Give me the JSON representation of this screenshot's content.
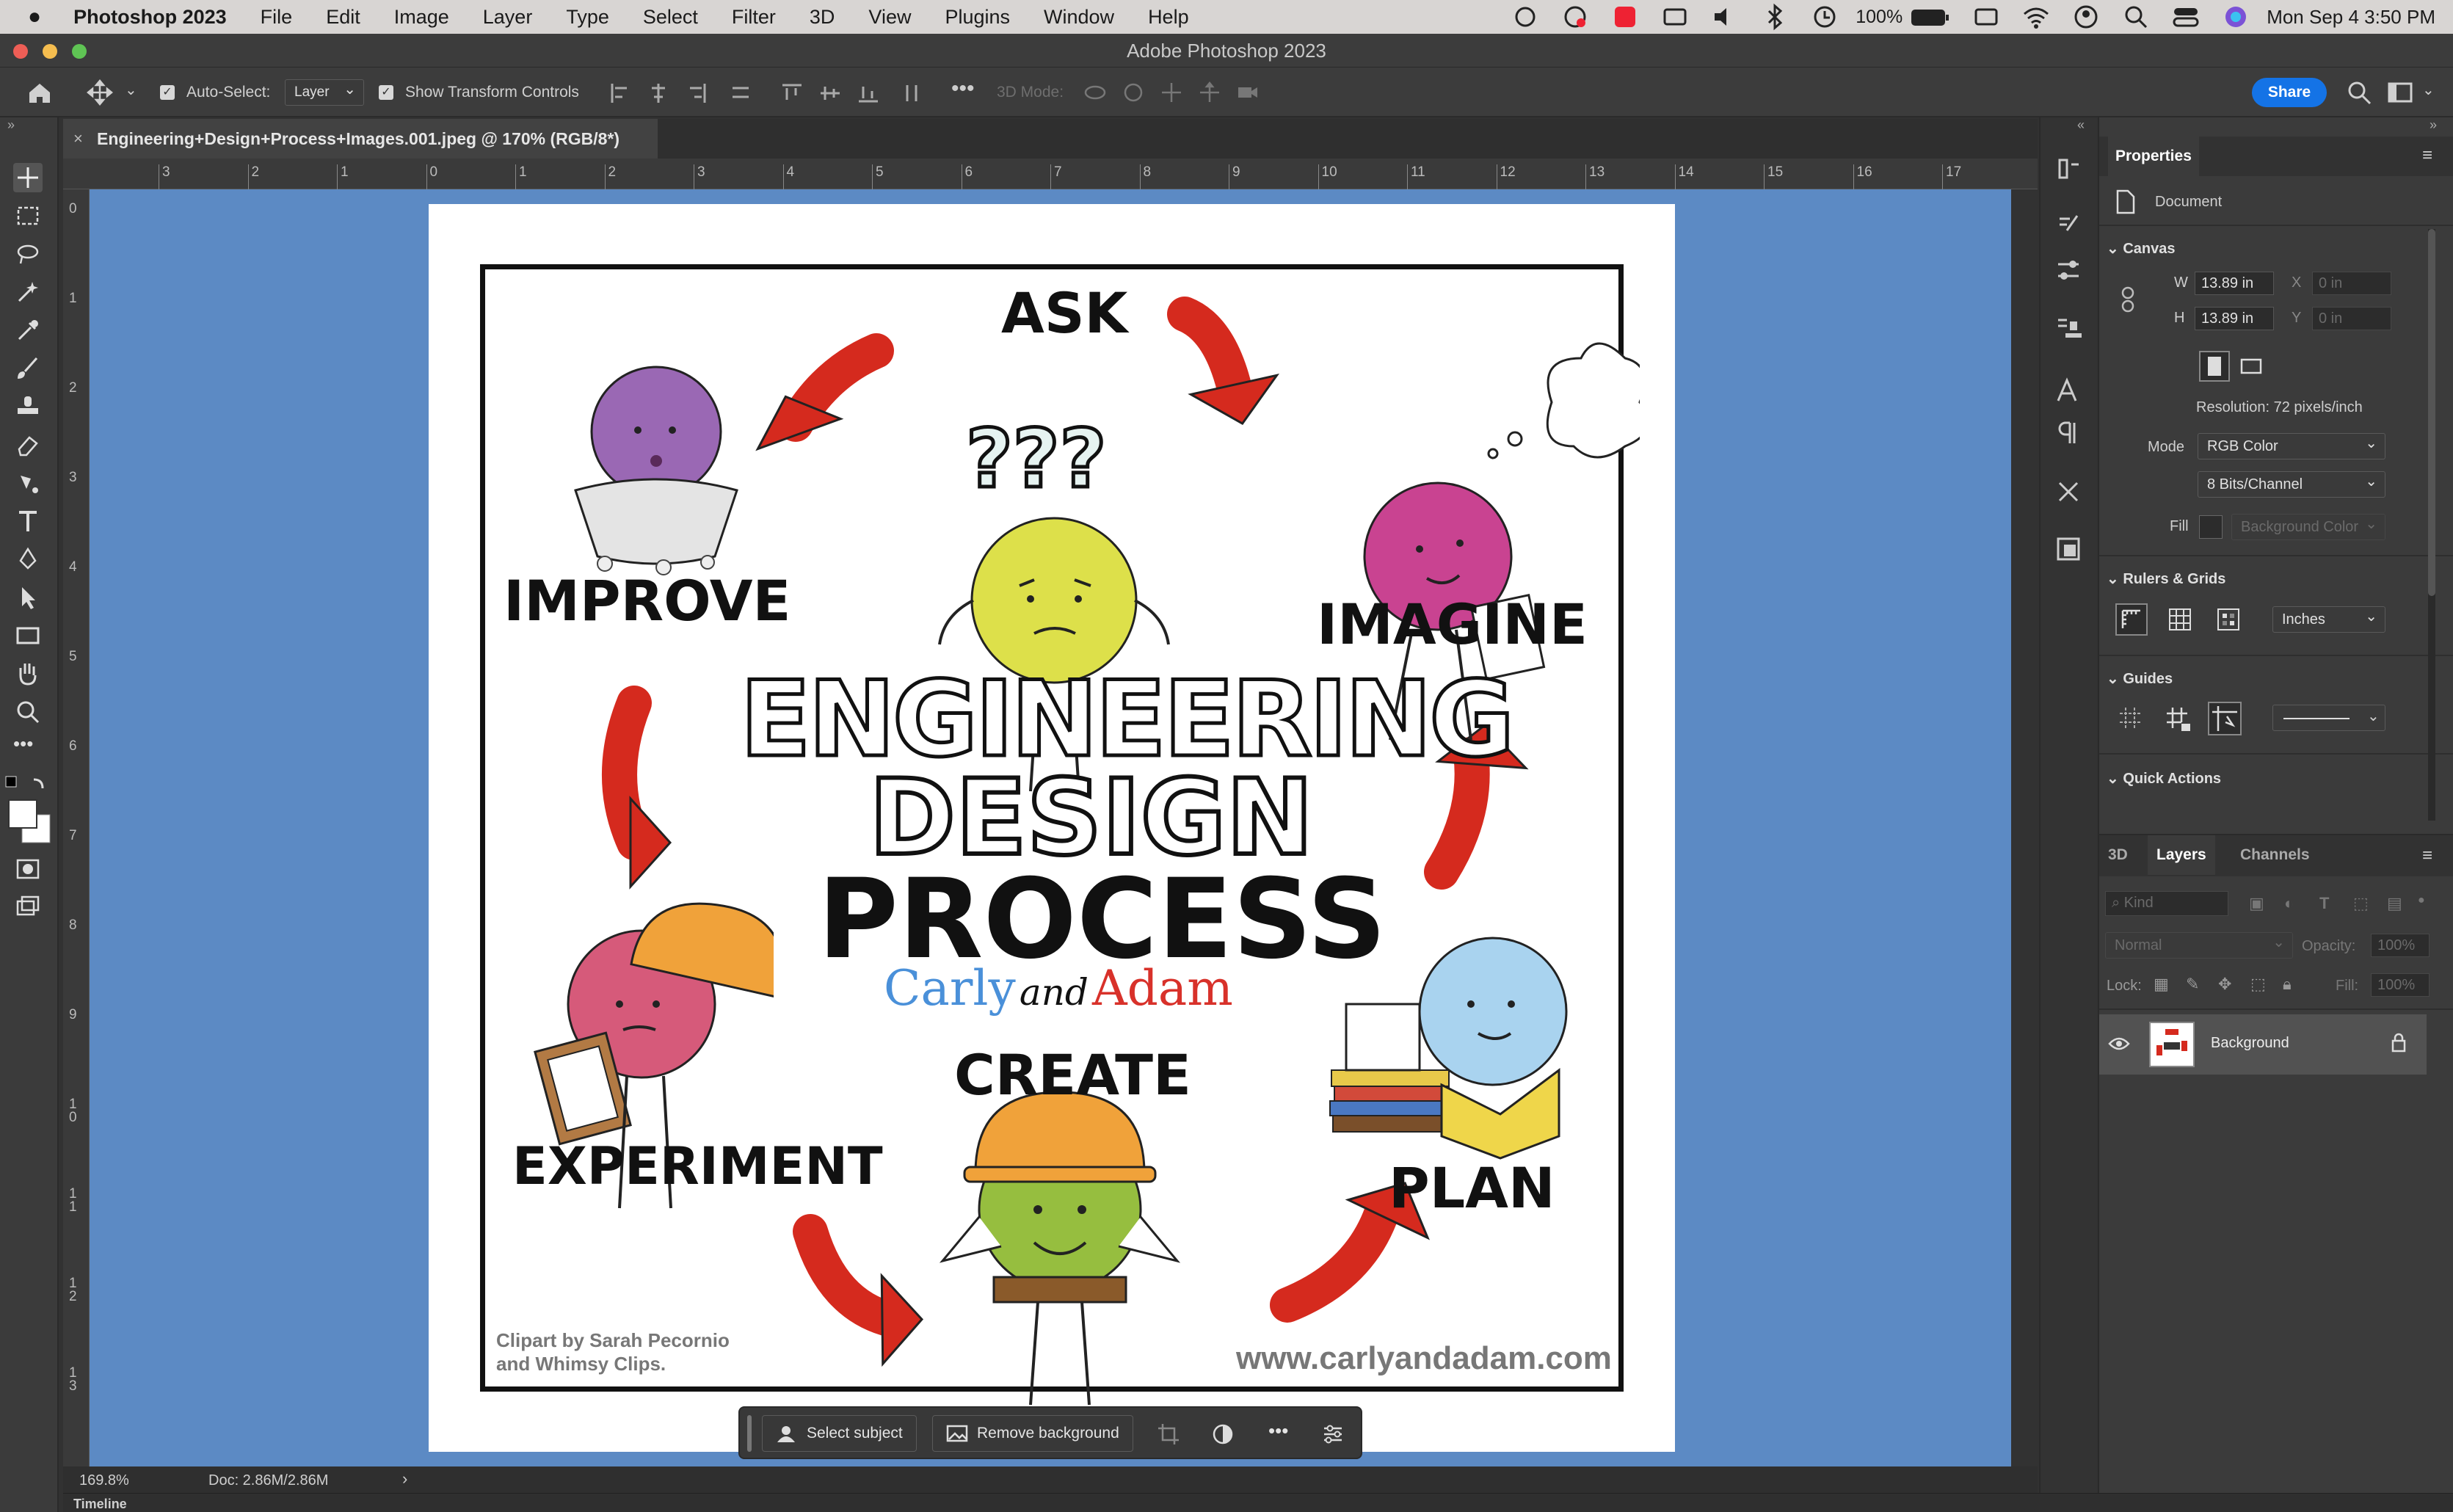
{
  "menubar": {
    "app_name": "Photoshop 2023",
    "items": [
      "File",
      "Edit",
      "Image",
      "Layer",
      "Type",
      "Select",
      "Filter",
      "3D",
      "View",
      "Plugins",
      "Window",
      "Help"
    ],
    "battery": "100%",
    "datetime": "Mon Sep 4  3:50 PM"
  },
  "window": {
    "title": "Adobe Photoshop 2023"
  },
  "options": {
    "auto_select_label": "Auto-Select:",
    "auto_select_value": "Layer",
    "transform_label": "Show Transform Controls",
    "mode_3d_label": "3D Mode:",
    "share_label": "Share"
  },
  "document": {
    "tab_title": "Engineering+Design+Process+Images.001.jpeg @ 170% (RGB/8*)",
    "zoom": "169.8%",
    "doc_size": "Doc: 2.86M/2.86M",
    "ruler_top": [
      "3",
      "2",
      "1",
      "0",
      "1",
      "2",
      "3",
      "4",
      "5",
      "6",
      "7",
      "8",
      "9",
      "10",
      "11",
      "12",
      "13",
      "14",
      "15",
      "16",
      "17"
    ],
    "ruler_left": [
      "0",
      "1",
      "2",
      "3",
      "4",
      "5",
      "6",
      "7",
      "8",
      "9",
      "1 0",
      "1 1",
      "1 2",
      "1 3"
    ]
  },
  "artwork": {
    "title_line1": "ENGINEERING",
    "title_line2": "DESIGN",
    "title_line3": "PROCESS",
    "brand_1": "Carly",
    "brand_and": "and",
    "brand_2": "Adam",
    "steps": [
      "ASK",
      "IMAGINE",
      "PLAN",
      "CREATE",
      "EXPERIMENT",
      "IMPROVE"
    ],
    "credit_line1": "Clipart by Sarah Pecornio",
    "credit_line2": "and Whimsy Clips.",
    "website": "www.carlyandadam.com",
    "question_marks": "???",
    "colors": {
      "arrow": "#d52a1e",
      "ask": "#dde04a",
      "imagine": "#c94391",
      "plan": "#a9d3ef",
      "create": "#96be3f",
      "experiment": "#d65a7a",
      "improve": "#9a68b4",
      "hat": "#f0a23a",
      "carly": "#4a90d9",
      "adam": "#d8312a"
    }
  },
  "context_bar": {
    "select_subject": "Select subject",
    "remove_background": "Remove background"
  },
  "properties": {
    "title": "Properties",
    "doc_label": "Document",
    "canvas_title": "Canvas",
    "w_label": "W",
    "w_value": "13.89 in",
    "h_label": "H",
    "h_value": "13.89 in",
    "x_label": "X",
    "x_value": "0 in",
    "y_label": "Y",
    "y_value": "0 in",
    "resolution": "Resolution: 72 pixels/inch",
    "mode_label": "Mode",
    "mode_value": "RGB Color",
    "bits_value": "8 Bits/Channel",
    "fill_label": "Fill",
    "fill_value": "Background Color",
    "rulers_title": "Rulers & Grids",
    "units_value": "Inches",
    "guides_title": "Guides",
    "quick_actions_title": "Quick Actions"
  },
  "layers_panel": {
    "tabs": [
      "3D",
      "Layers",
      "Channels"
    ],
    "kind_placeholder": "Kind",
    "blend_mode": "Normal",
    "opacity_label": "Opacity:",
    "opacity_value": "100%",
    "lock_label": "Lock:",
    "fill_label": "Fill:",
    "fill_value": "100%",
    "layer_name": "Background"
  },
  "timeline_label": "Timeline"
}
